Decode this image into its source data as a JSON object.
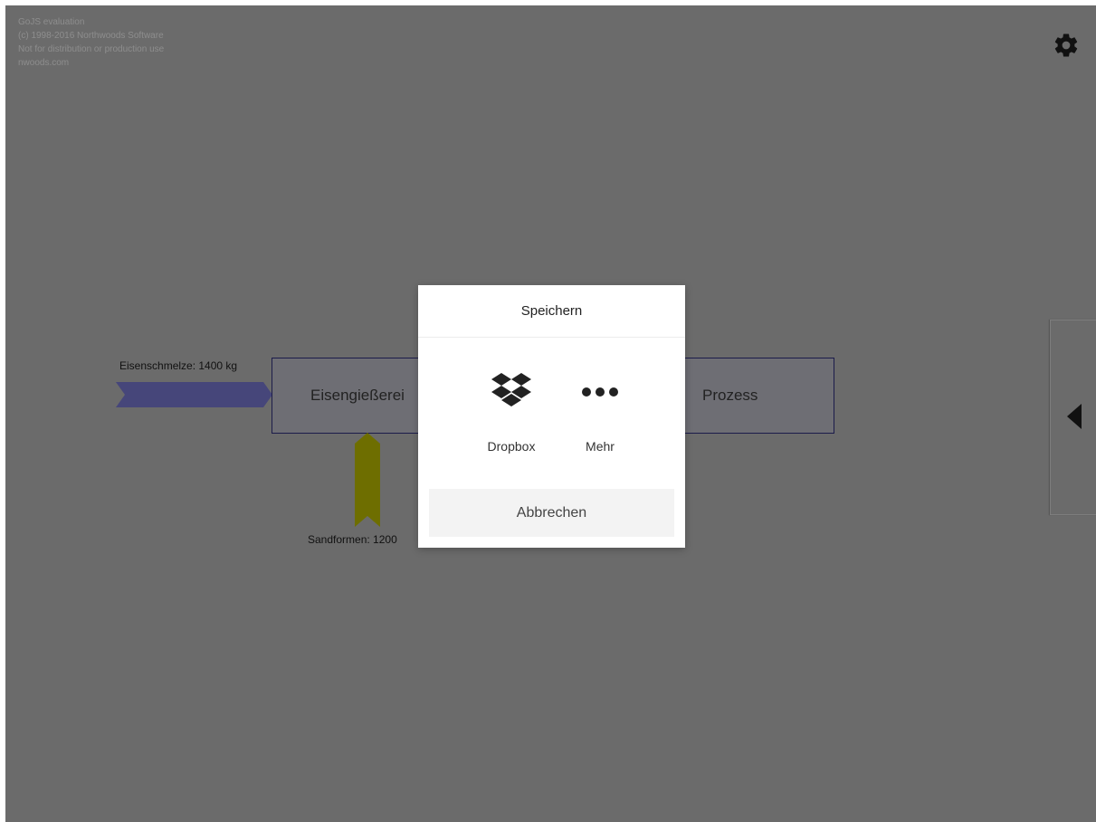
{
  "watermark": {
    "lines": [
      "GoJS evaluation",
      "(c) 1998-2016 Northwoods Software",
      "Not for distribution or production use",
      "nwoods.com"
    ]
  },
  "toolbar": {
    "settings_icon": "gear-icon"
  },
  "side_panel": {
    "toggle_icon": "triangle-left-icon"
  },
  "diagram": {
    "nodes": [
      {
        "label": "Eisengießerei"
      },
      {
        "label": "Prozess"
      }
    ],
    "links": [
      {
        "label": "Eisenschmelze: 1400 kg",
        "color": "#46467a"
      },
      {
        "label": "Sandformen: 1200",
        "color": "#6e6e00"
      }
    ]
  },
  "dialog": {
    "title": "Speichern",
    "options": [
      {
        "label": "Dropbox",
        "icon": "dropbox-icon"
      },
      {
        "label": "Mehr",
        "icon": "more-dots-icon"
      }
    ],
    "cancel_label": "Abbrechen"
  }
}
